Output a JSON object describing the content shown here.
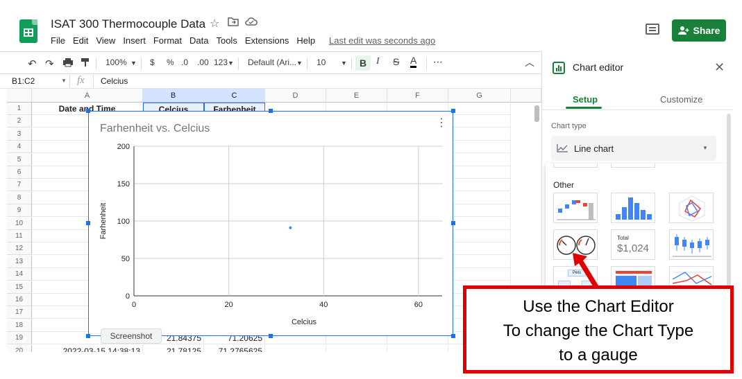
{
  "header": {
    "title": "ISAT 300 Thermocouple Data",
    "menu": [
      "File",
      "Edit",
      "View",
      "Insert",
      "Format",
      "Data",
      "Tools",
      "Extensions",
      "Help"
    ],
    "last_edit": "Last edit was seconds ago",
    "share_label": "Share"
  },
  "toolbar": {
    "zoom": "100%",
    "currency": "$",
    "percent": "%",
    "dec_decrease": ".0",
    "dec_increase": ".00",
    "format_more": "123",
    "font": "Default (Ari...",
    "font_size": "10",
    "bold": "B",
    "italic": "I",
    "strike": "S",
    "text_color": "A",
    "more": "⋯"
  },
  "formula_bar": {
    "name_box": "B1:C2",
    "fx": "fx",
    "value": "Celcius"
  },
  "grid": {
    "columns": [
      "A",
      "B",
      "C",
      "D",
      "E",
      "F",
      "G"
    ],
    "rows": [
      {
        "n": "1",
        "a": "Date and Time",
        "b": "Celcius",
        "c": "Farhenheit"
      },
      {
        "n": "2",
        "a": "2022-0",
        "b": "",
        "c": ""
      },
      {
        "n": "3",
        "a": "2022-0",
        "b": "",
        "c": ""
      },
      {
        "n": "4",
        "a": "2022-0",
        "b": "",
        "c": ""
      },
      {
        "n": "5",
        "a": "2022-0",
        "b": "",
        "c": ""
      },
      {
        "n": "6",
        "a": "2022-0",
        "b": "",
        "c": ""
      },
      {
        "n": "7",
        "a": "2022-0",
        "b": "",
        "c": ""
      },
      {
        "n": "8",
        "a": "2022-0",
        "b": "",
        "c": ""
      },
      {
        "n": "9",
        "a": "2022-0",
        "b": "",
        "c": ""
      },
      {
        "n": "10",
        "a": "2022-0",
        "b": "",
        "c": ""
      },
      {
        "n": "11",
        "a": "2022-0",
        "b": "",
        "c": ""
      },
      {
        "n": "12",
        "a": "2022-0",
        "b": "",
        "c": ""
      },
      {
        "n": "13",
        "a": "2022-0",
        "b": "",
        "c": ""
      },
      {
        "n": "14",
        "a": "2022-0",
        "b": "",
        "c": ""
      },
      {
        "n": "15",
        "a": "2022-0",
        "b": "",
        "c": ""
      },
      {
        "n": "16",
        "a": "2022-0",
        "b": "",
        "c": ""
      },
      {
        "n": "17",
        "a": "2022-0",
        "b": "",
        "c": ""
      },
      {
        "n": "18",
        "a": "2022-0",
        "b": "",
        "c": ""
      },
      {
        "n": "19",
        "a": "2022-03-1",
        "b": "21.84375",
        "c": "71.20625"
      },
      {
        "n": "20",
        "a": "2022-03-15 14:38:13",
        "b": "21.78125",
        "c": "71.2765625"
      }
    ]
  },
  "chart": {
    "title": "Farhenheit vs. Celcius",
    "xlabel": "Celcius",
    "ylabel": "Farhenheit",
    "x_ticks": [
      "0",
      "20",
      "40",
      "60"
    ],
    "y_ticks": [
      "0",
      "50",
      "100",
      "150",
      "200"
    ],
    "point": {
      "x": 33,
      "y": 91
    },
    "xlim": [
      0,
      65
    ],
    "ylim": [
      0,
      200
    ],
    "menu_icon": "⋮"
  },
  "tooltip": {
    "label": "Screenshot"
  },
  "panel": {
    "title": "Chart editor",
    "tab_setup": "Setup",
    "tab_customize": "Customize",
    "chart_type_label": "Chart type",
    "chart_type_value": "Line chart",
    "other_heading": "Other",
    "scorecard_total": "Total",
    "scorecard_value": "$1,024",
    "org_label": "Pets"
  },
  "callout": {
    "line1": "Use the Chart Editor",
    "line2": "To change the Chart Type",
    "line3": "to a gauge"
  },
  "colors": {
    "accent_green": "#188038",
    "selection_blue": "#1a73e8",
    "callout_red": "#e00000"
  }
}
